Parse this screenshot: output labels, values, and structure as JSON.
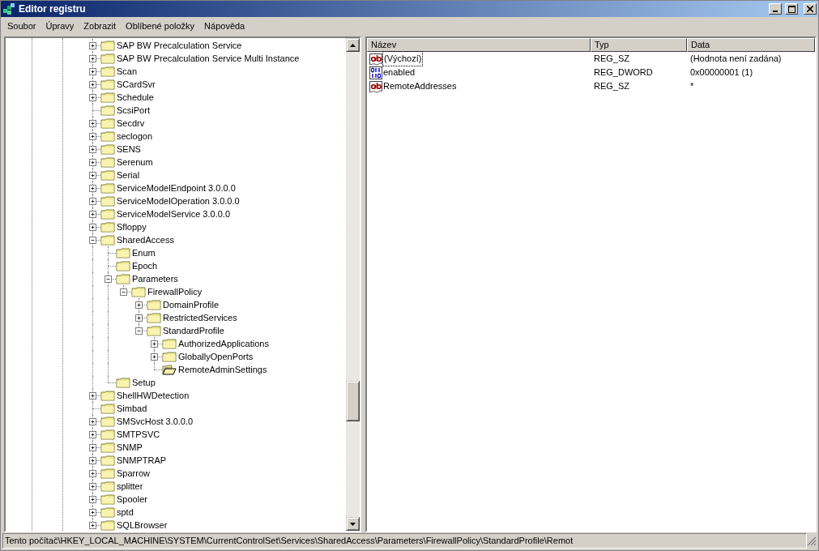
{
  "window": {
    "title": "Editor registru"
  },
  "menu": [
    "Soubor",
    "Úpravy",
    "Zobrazit",
    "Oblíbené položky",
    "Nápověda"
  ],
  "tree": [
    {
      "label": "SAP BW Precalculation Service",
      "expanded": false,
      "selected": false
    },
    {
      "label": "SAP BW Precalculation Service Multi Instance",
      "expanded": false,
      "selected": false
    },
    {
      "label": "Scan",
      "expanded": false,
      "selected": false
    },
    {
      "label": "SCardSvr",
      "expanded": false,
      "selected": false
    },
    {
      "label": "Schedule",
      "expanded": false,
      "selected": false
    },
    {
      "label": "ScsiPort",
      "selected": false
    },
    {
      "label": "Secdrv",
      "expanded": false,
      "selected": false
    },
    {
      "label": "seclogon",
      "expanded": false,
      "selected": false
    },
    {
      "label": "SENS",
      "expanded": false,
      "selected": false
    },
    {
      "label": "Serenum",
      "expanded": false,
      "selected": false
    },
    {
      "label": "Serial",
      "expanded": false,
      "selected": false
    },
    {
      "label": "ServiceModelEndpoint 3.0.0.0",
      "expanded": false,
      "selected": false
    },
    {
      "label": "ServiceModelOperation 3.0.0.0",
      "expanded": false,
      "selected": false
    },
    {
      "label": "ServiceModelService 3.0.0.0",
      "expanded": false,
      "selected": false
    },
    {
      "label": "Sfloppy",
      "expanded": false,
      "selected": false
    },
    {
      "label": "SharedAccess",
      "expanded": true,
      "selected": false,
      "children": [
        {
          "label": "Enum",
          "selected": false
        },
        {
          "label": "Epoch",
          "selected": false
        },
        {
          "label": "Parameters",
          "expanded": true,
          "selected": false,
          "children": [
            {
              "label": "FirewallPolicy",
              "expanded": true,
              "selected": false,
              "children": [
                {
                  "label": "DomainProfile",
                  "expanded": false,
                  "selected": false
                },
                {
                  "label": "RestrictedServices",
                  "expanded": false,
                  "selected": false
                },
                {
                  "label": "StandardProfile",
                  "expanded": true,
                  "selected": false,
                  "children": [
                    {
                      "label": "AuthorizedApplications",
                      "expanded": false,
                      "selected": false
                    },
                    {
                      "label": "GloballyOpenPorts",
                      "expanded": false,
                      "selected": false
                    },
                    {
                      "label": "RemoteAdminSettings",
                      "selected": true
                    }
                  ]
                }
              ]
            }
          ]
        },
        {
          "label": "Setup",
          "selected": false
        }
      ]
    },
    {
      "label": "ShellHWDetection",
      "expanded": false,
      "selected": false
    },
    {
      "label": "Simbad",
      "selected": false
    },
    {
      "label": "SMSvcHost 3.0.0.0",
      "expanded": false,
      "selected": false
    },
    {
      "label": "SMTPSVC",
      "expanded": false,
      "selected": false
    },
    {
      "label": "SNMP",
      "expanded": false,
      "selected": false
    },
    {
      "label": "SNMPTRAP",
      "expanded": false,
      "selected": false
    },
    {
      "label": "Sparrow",
      "expanded": false,
      "selected": false
    },
    {
      "label": "splitter",
      "expanded": false,
      "selected": false
    },
    {
      "label": "Spooler",
      "expanded": false,
      "selected": false
    },
    {
      "label": "sptd",
      "expanded": false,
      "selected": false
    },
    {
      "label": "SQLBrowser",
      "expanded": false,
      "selected": false
    }
  ],
  "values": {
    "columns": [
      "Název",
      "Typ",
      "Data"
    ],
    "rows": [
      {
        "kind": "string",
        "name": "(Výchozí)",
        "type": "REG_SZ",
        "data": "(Hodnota není zadána)",
        "focused": true
      },
      {
        "kind": "binary",
        "name": "enabled",
        "type": "REG_DWORD",
        "data": "0x00000001 (1)",
        "focused": false
      },
      {
        "kind": "string",
        "name": "RemoteAddresses",
        "type": "REG_SZ",
        "data": "*",
        "focused": false
      }
    ]
  },
  "status_bar": "Tento počítač\\HKEY_LOCAL_MACHINE\\SYSTEM\\CurrentControlSet\\Services\\SharedAccess\\Parameters\\FirewallPolicy\\StandardProfile\\Remot"
}
